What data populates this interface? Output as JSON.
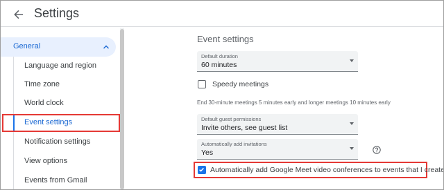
{
  "header": {
    "title": "Settings",
    "back_icon": "arrow-back-icon"
  },
  "sidebar": {
    "general_label": "General",
    "items": [
      {
        "label": "Language and region"
      },
      {
        "label": "Time zone"
      },
      {
        "label": "World clock"
      },
      {
        "label": "Event settings",
        "selected": true
      },
      {
        "label": "Notification settings"
      },
      {
        "label": "View options"
      },
      {
        "label": "Events from Gmail"
      }
    ]
  },
  "main": {
    "section_title": "Event settings",
    "default_duration": {
      "label": "Default duration",
      "value": "60 minutes"
    },
    "speedy_meetings": {
      "label": "Speedy meetings",
      "checked": false
    },
    "helper_text": "End 30-minute meetings 5 minutes early and longer meetings 10 minutes early",
    "guest_permissions": {
      "label": "Default guest permissions",
      "value": "Invite others, see guest list"
    },
    "auto_invitations": {
      "label": "Automatically add invitations",
      "value": "Yes"
    },
    "google_meet": {
      "label": "Automatically add Google Meet video conferences to events that I create",
      "checked": true
    }
  },
  "colors": {
    "accent": "#1a73e8",
    "highlight": "#e53935",
    "selected_bg": "#e8f0fe"
  }
}
